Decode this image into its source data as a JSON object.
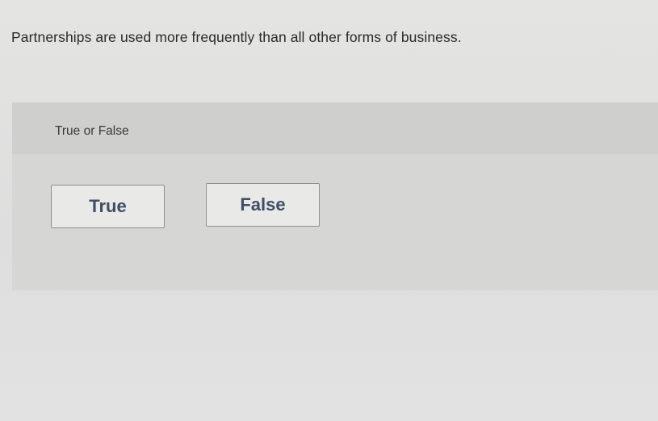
{
  "question": {
    "text": "Partnerships are used more frequently than all other forms of business."
  },
  "answer_area": {
    "type_label": "True or False",
    "choices": [
      {
        "label": "True"
      },
      {
        "label": "False"
      }
    ]
  }
}
